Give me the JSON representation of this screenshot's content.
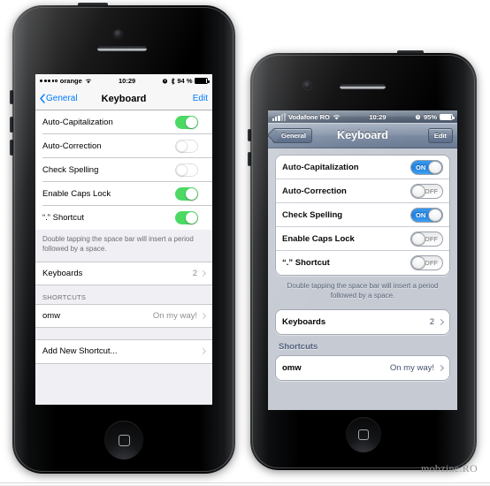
{
  "watermark": "mobzine.RO",
  "phone_left": {
    "os": "iOS 7",
    "status": {
      "carrier": "orange",
      "time": "10:29",
      "battery": "94 %",
      "icons": [
        "alarm-icon",
        "bluetooth-icon",
        "battery-icon"
      ]
    },
    "nav": {
      "back": "General",
      "title": "Keyboard",
      "edit": "Edit"
    },
    "rows": [
      {
        "label": "Auto-Capitalization",
        "toggle": "on"
      },
      {
        "label": "Auto-Correction",
        "toggle": "off"
      },
      {
        "label": "Check Spelling",
        "toggle": "off"
      },
      {
        "label": "Enable Caps Lock",
        "toggle": "on"
      },
      {
        "label": "“.” Shortcut",
        "toggle": "on"
      }
    ],
    "footer": "Double tapping the space bar will insert a period followed by a space.",
    "keyboards": {
      "label": "Keyboards",
      "value": "2"
    },
    "shortcuts_header": "SHORTCUTS",
    "shortcut": {
      "label": "omw",
      "value": "On my way!"
    },
    "add_shortcut": "Add New Shortcut..."
  },
  "phone_right": {
    "os": "iOS 6",
    "status": {
      "carrier": "Vodafone RO",
      "time": "10:29",
      "battery": "95%",
      "icons": [
        "signal-bars-icon",
        "wifi-icon",
        "alarm-icon",
        "battery-icon"
      ]
    },
    "nav": {
      "back": "General",
      "title": "Keyboard",
      "edit": "Edit"
    },
    "rows": [
      {
        "label": "Auto-Capitalization",
        "toggle": "on",
        "toggle_text": "ON"
      },
      {
        "label": "Auto-Correction",
        "toggle": "off",
        "toggle_text": "OFF"
      },
      {
        "label": "Check Spelling",
        "toggle": "on",
        "toggle_text": "ON"
      },
      {
        "label": "Enable Caps Lock",
        "toggle": "off",
        "toggle_text": "OFF"
      },
      {
        "label": "“.” Shortcut",
        "toggle": "off",
        "toggle_text": "OFF"
      }
    ],
    "footer": "Double tapping the space bar will insert a period followed by a space.",
    "keyboards": {
      "label": "Keyboards",
      "value": "2"
    },
    "shortcuts_header": "Shortcuts",
    "shortcut": {
      "label": "omw",
      "value": "On my way!"
    }
  },
  "colors": {
    "ios7_accent": "#007aff",
    "ios7_switch_on": "#4cd964",
    "ios6_switch_on": "#1e7fe0",
    "ios7_group_bg": "#efeff4",
    "ios6_group_bg": "#c5cad3"
  }
}
